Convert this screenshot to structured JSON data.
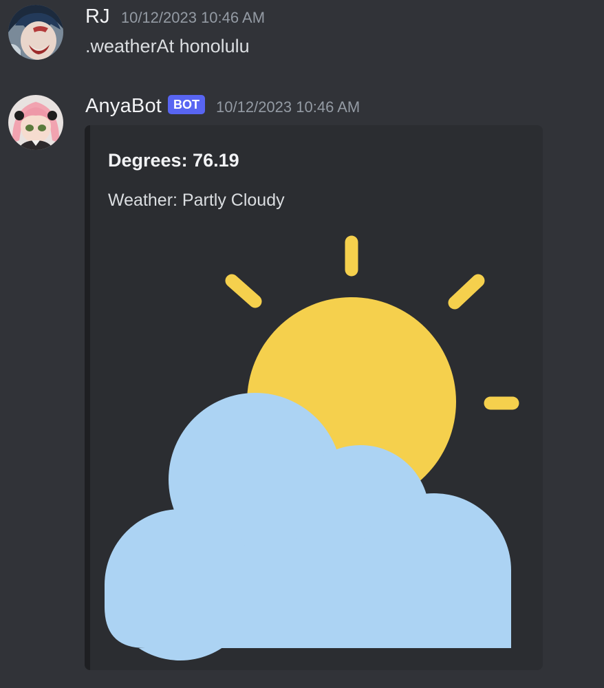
{
  "messages": [
    {
      "username": "RJ",
      "timestamp": "10/12/2023 10:46 AM",
      "content": ".weatherAt honolulu",
      "avatar_icon": "anime-character-avatar-icon"
    },
    {
      "username": "AnyaBot",
      "bot_tag": "BOT",
      "timestamp": "10/12/2023 10:46 AM",
      "avatar_icon": "anime-girl-pink-hair-avatar-icon",
      "embed": {
        "title": "Degrees: 76.19",
        "description": "Weather: Partly Cloudy",
        "image_icon": "partly-cloudy-weather-icon"
      }
    }
  ],
  "colors": {
    "background": "#313338",
    "embed_background": "#2b2d31",
    "embed_border": "#1e1f22",
    "bot_tag": "#5865f2",
    "sun": "#f5d04d",
    "cloud": "#acd3f3"
  }
}
